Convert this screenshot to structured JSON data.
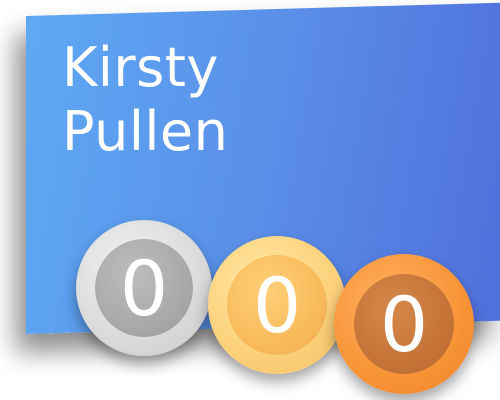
{
  "profile": {
    "name_line1": "Kirsty",
    "name_line2": "Pullen"
  },
  "medals": {
    "silver": {
      "count": "0",
      "icon": "silver-medal-icon",
      "color": "#a9a9a9"
    },
    "gold": {
      "count": "0",
      "icon": "gold-medal-icon",
      "color": "#f8bb5c"
    },
    "bronze": {
      "count": "0",
      "icon": "bronze-medal-icon",
      "color": "#c57438"
    }
  },
  "colors": {
    "card_start": "#5ea9f4",
    "card_end": "#4f6fdc"
  }
}
